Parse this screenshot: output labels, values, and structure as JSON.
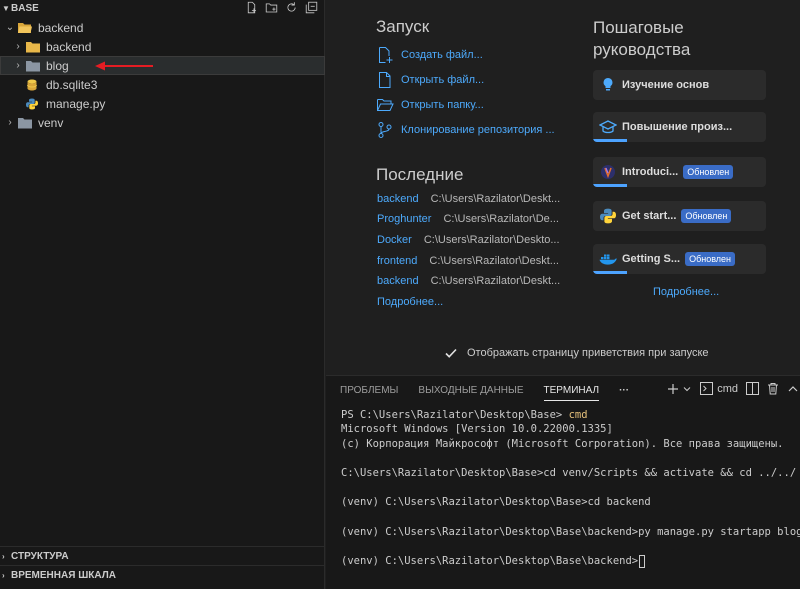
{
  "explorer": {
    "title": "BASE",
    "tree": [
      {
        "label": "backend",
        "kind": "folder-open",
        "depth": 0,
        "twisty": "v"
      },
      {
        "label": "backend",
        "kind": "folder",
        "depth": 1,
        "twisty": ">"
      },
      {
        "label": "blog",
        "kind": "folder-plain",
        "depth": 1,
        "twisty": ">",
        "selected": true
      },
      {
        "label": "db.sqlite3",
        "kind": "database",
        "depth": 1,
        "twisty": ""
      },
      {
        "label": "manage.py",
        "kind": "python",
        "depth": 1,
        "twisty": ""
      },
      {
        "label": "venv",
        "kind": "folder-plain",
        "depth": 0,
        "twisty": ">"
      }
    ],
    "bottom_sections": [
      "СТРУКТУРА",
      "ВРЕМЕННАЯ ШКАЛА"
    ]
  },
  "welcome": {
    "start_title": "Запуск",
    "start_items": [
      {
        "label": "Создать файл...",
        "icon": "new-file-icon"
      },
      {
        "label": "Открыть файл...",
        "icon": "open-file-icon"
      },
      {
        "label": "Открыть папку...",
        "icon": "open-folder-icon"
      },
      {
        "label": "Клонирование репозитория ...",
        "icon": "git-branch-icon"
      }
    ],
    "recent_title": "Последние",
    "recent": [
      {
        "name": "backend",
        "path": "C:\\Users\\Razilator\\Deskt..."
      },
      {
        "name": "Proghunter",
        "path": "C:\\Users\\Razilator\\De..."
      },
      {
        "name": "Docker",
        "path": "C:\\Users\\Razilator\\Deskto..."
      },
      {
        "name": "frontend",
        "path": "C:\\Users\\Razilator\\Deskt..."
      },
      {
        "name": "backend",
        "path": "C:\\Users\\Razilator\\Deskt..."
      }
    ],
    "recent_more": "Подробнее...",
    "walkthroughs_title_1": "Пошаговые",
    "walkthroughs_title_2": "руководства",
    "walkthroughs": [
      {
        "label": "Изучение основ",
        "icon": "lightbulb-icon",
        "badge": ""
      },
      {
        "label": "Повышение произ...",
        "icon": "mortarboard-icon",
        "badge": ""
      },
      {
        "label": "Introduci...",
        "icon": "jupyter-icon",
        "badge": "Обновлен"
      },
      {
        "label": "Get start...",
        "icon": "python-icon",
        "badge": "Обновлен"
      },
      {
        "label": "Getting S...",
        "icon": "docker-icon",
        "badge": "Обновлен"
      }
    ],
    "walkthroughs_more": "Подробнее...",
    "show_on_startup": "Отображать страницу приветствия при запуске",
    "show_on_startup_checked": true
  },
  "panel": {
    "tabs": [
      "ПРОБЛЕМЫ",
      "ВЫХОДНЫЕ ДАННЫЕ",
      "ТЕРМИНАЛ"
    ],
    "active_tab": "ТЕРМИНАЛ",
    "more": "···",
    "terminal_label": "cmd",
    "terminal": {
      "l1_prompt": "PS C:\\Users\\Razilator\\Desktop\\Base> ",
      "l1_cmd": "cmd",
      "l2": "Microsoft Windows [Version 10.0.22000.1335]",
      "l3": "(c) Корпорация Майкрософт (Microsoft Corporation). Все права защищены.",
      "l4": "C:\\Users\\Razilator\\Desktop\\Base>cd venv/Scripts && activate && cd ../../",
      "l5": "(venv) C:\\Users\\Razilator\\Desktop\\Base>cd backend",
      "l6": "(venv) C:\\Users\\Razilator\\Desktop\\Base\\backend>py manage.py startapp blog",
      "l7": "(venv) C:\\Users\\Razilator\\Desktop\\Base\\backend>"
    }
  },
  "colors": {
    "accent": "#4daafc",
    "badge": "#3a6cc6",
    "arrow": "#e51c23",
    "folder": "#e8b749"
  }
}
